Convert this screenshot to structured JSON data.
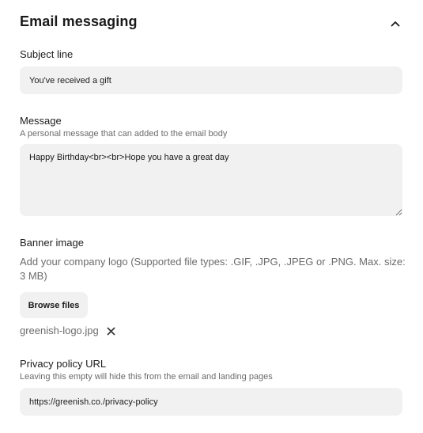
{
  "section": {
    "title": "Email messaging",
    "toggle_icon": "chevron-up-icon"
  },
  "subject": {
    "label": "Subject line",
    "value": "You've received a gift"
  },
  "message": {
    "label": "Message",
    "hint": "A personal message that can added to the email body",
    "value": "Happy Birthday<br><br>Hope you have a great day"
  },
  "banner": {
    "label": "Banner image",
    "description": "Add your company logo (Supported file types: .GIF, .JPG, .JPEG or .PNG. Max. size: 3 MB)",
    "browse_label": "Browse files",
    "file_name": "greenish-logo.jpg",
    "remove_icon": "close-icon"
  },
  "privacy": {
    "label": "Privacy policy URL",
    "hint": "Leaving this empty will hide this from the email and landing pages",
    "value": "https://greenish.co./privacy-policy"
  }
}
